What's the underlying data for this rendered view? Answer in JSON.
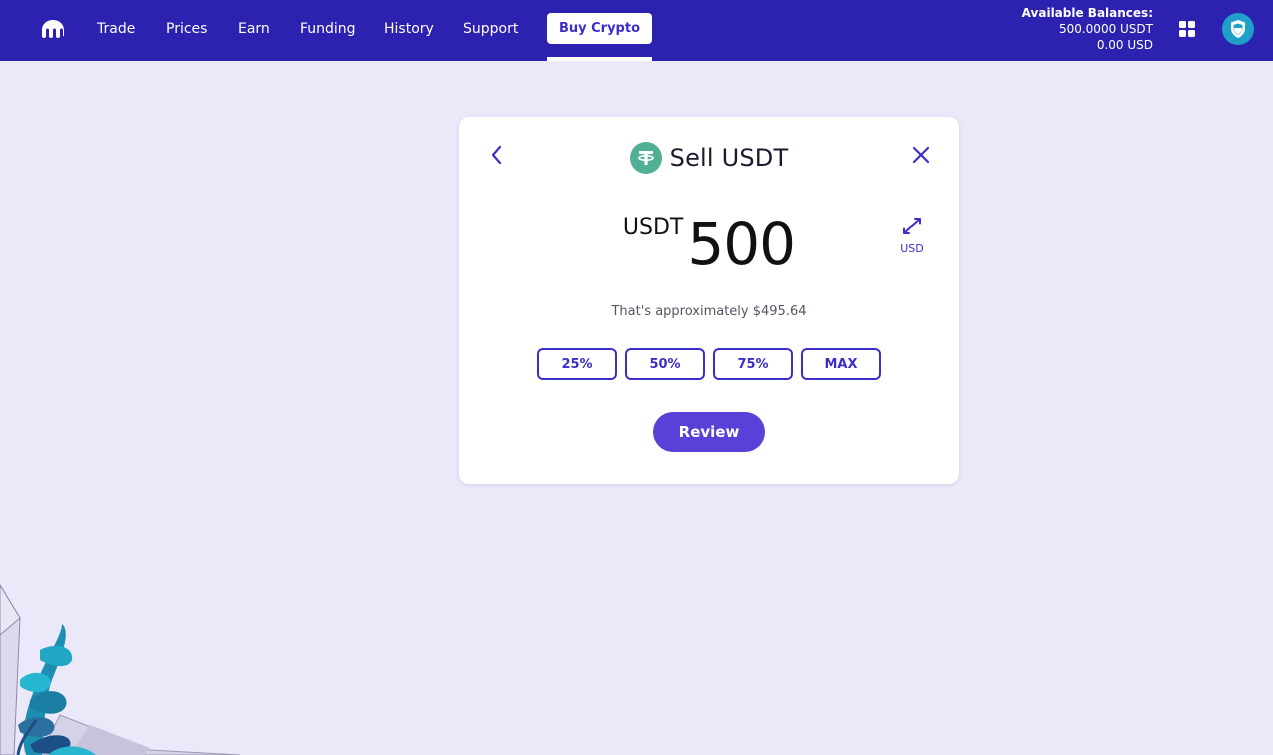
{
  "nav": {
    "items": [
      "Trade",
      "Prices",
      "Earn",
      "Funding",
      "History",
      "Support"
    ],
    "buy_crypto": "Buy Crypto"
  },
  "balances": {
    "label": "Available Balances:",
    "usdt": "500.0000 USDT",
    "usd": "0.00 USD"
  },
  "card": {
    "title": "Sell USDT",
    "amount_currency": "USDT",
    "amount_value": "500",
    "swap_label": "USD",
    "approx_text": "That's approximately $495.64",
    "percent_buttons": [
      "25%",
      "50%",
      "75%",
      "MAX"
    ],
    "review_label": "Review"
  },
  "colors": {
    "topbar": "#2d22b0",
    "accent": "#3b2fc9",
    "review": "#5741d9",
    "background": "#ebe8f9",
    "tether": "#50af95"
  },
  "icons": {
    "logo": "kraken-logo-icon",
    "apps": "grid-icon",
    "account": "shield-icon",
    "back": "chevron-left-icon",
    "close": "close-icon",
    "swap": "swap-arrows-icon",
    "asset": "tether-icon"
  }
}
